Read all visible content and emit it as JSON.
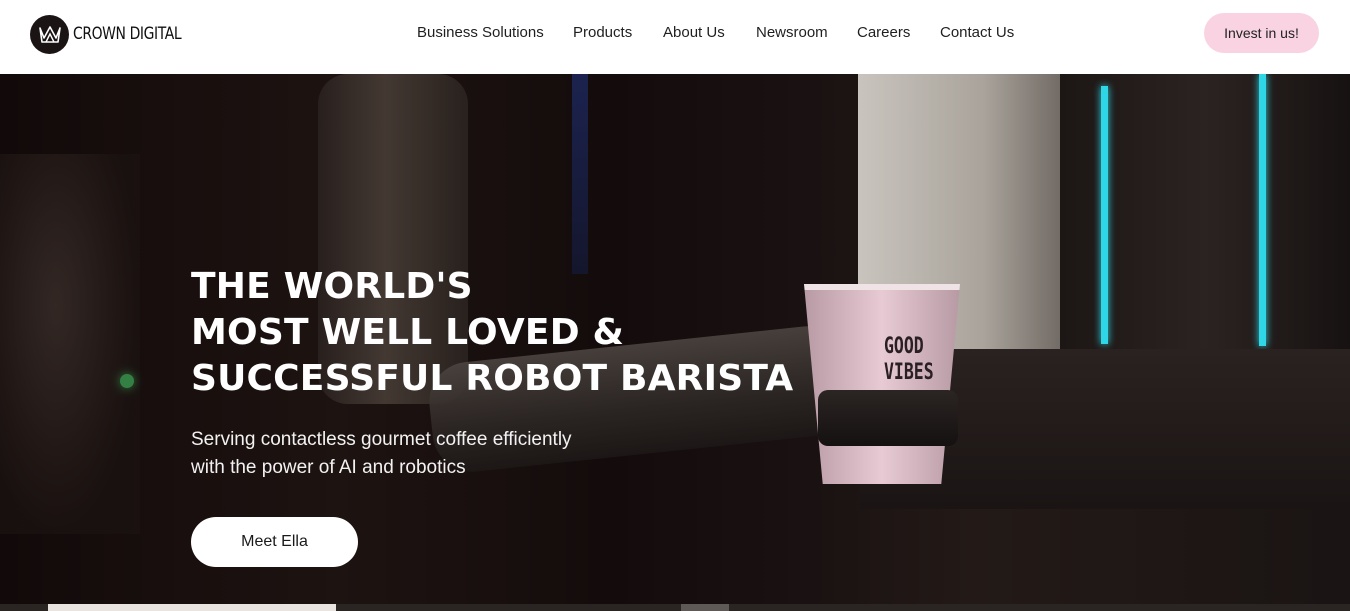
{
  "header": {
    "brand": "CROWN DIGITAL",
    "nav": [
      {
        "label": "Business Solutions"
      },
      {
        "label": "Products"
      },
      {
        "label": "About Us"
      },
      {
        "label": "Newsroom"
      },
      {
        "label": "Careers"
      },
      {
        "label": "Contact Us"
      }
    ],
    "invest_label": "Invest in us!"
  },
  "hero": {
    "title_lines": [
      "THE WORLD'S",
      "MOST WELL LOVED &",
      "SUCCESSFUL ROBOT BARISTA"
    ],
    "subtitle_lines": [
      "Serving contactless gourmet coffee efficiently",
      "with the power of AI and robotics"
    ],
    "cta_label": "Meet Ella",
    "cup_text_lines": [
      "GOOD",
      "VIBES"
    ]
  },
  "colors": {
    "header_bg": "#ffffff",
    "invest_bg": "#f9d3e2",
    "hero_text": "#ffffff",
    "cyan_light": "#2fd7e6"
  },
  "icons": {
    "logo": "crown-icon"
  }
}
